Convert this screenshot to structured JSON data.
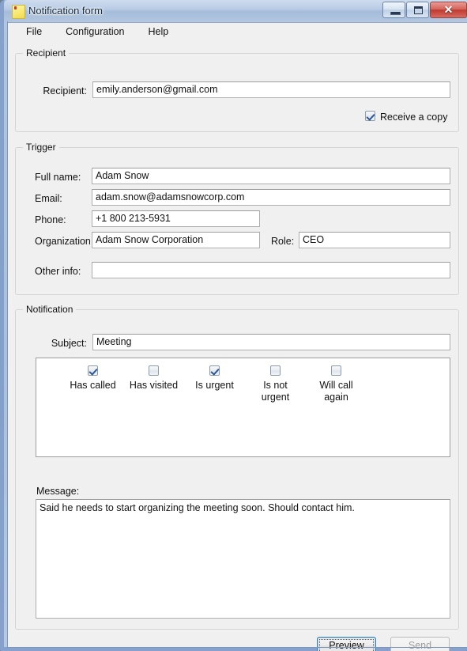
{
  "window": {
    "title": "Notification form",
    "icon": "note-icon",
    "controls": {
      "minimize": "minimize-button",
      "maximize": "maximize-button",
      "close": "✕"
    }
  },
  "menu": {
    "items": [
      {
        "label": "File"
      },
      {
        "label": "Configuration"
      },
      {
        "label": "Help"
      }
    ]
  },
  "recipient": {
    "group_title": "Recipient",
    "field_label": "Recipient:",
    "value": "emily.anderson@gmail.com",
    "receive_copy": {
      "label": "Receive a copy",
      "checked": true
    }
  },
  "trigger": {
    "group_title": "Trigger",
    "fields": [
      {
        "label": "Full name:",
        "value": "Adam Snow"
      },
      {
        "label": "Email:",
        "value": "adam.snow@adamsnowcorp.com"
      },
      {
        "label": "Phone:",
        "value": "+1 800 213-5931"
      },
      {
        "label": "Organization:",
        "value": "Adam Snow Corporation"
      },
      {
        "label": "Role:",
        "value": "CEO"
      },
      {
        "label": "Other info:",
        "value": ""
      }
    ]
  },
  "notification": {
    "group_title": "Notification",
    "subject_label": "Subject:",
    "subject_value": "Meeting",
    "options": [
      {
        "label": "Has called",
        "checked": true
      },
      {
        "label": "Has visited",
        "checked": false
      },
      {
        "label": "Is urgent",
        "checked": true
      },
      {
        "label": "Is not\nurgent",
        "line1": "Is not",
        "line2": "urgent",
        "checked": false
      },
      {
        "label": "Will call\nagain",
        "line1": "Will call",
        "line2": "again",
        "checked": false
      }
    ],
    "message_label": "Message:",
    "message_value": "Said he needs to start organizing the meeting soon. Should contact him."
  },
  "actions": {
    "preview": {
      "label": "Preview",
      "focused": true,
      "enabled": true
    },
    "send": {
      "label": "Send",
      "focused": false,
      "enabled": false
    }
  },
  "colors": {
    "accent": "#3c7fb1",
    "checkmark": "#2b5797",
    "close_button": "#bf3a30",
    "window_background": "#f0f0f0"
  }
}
